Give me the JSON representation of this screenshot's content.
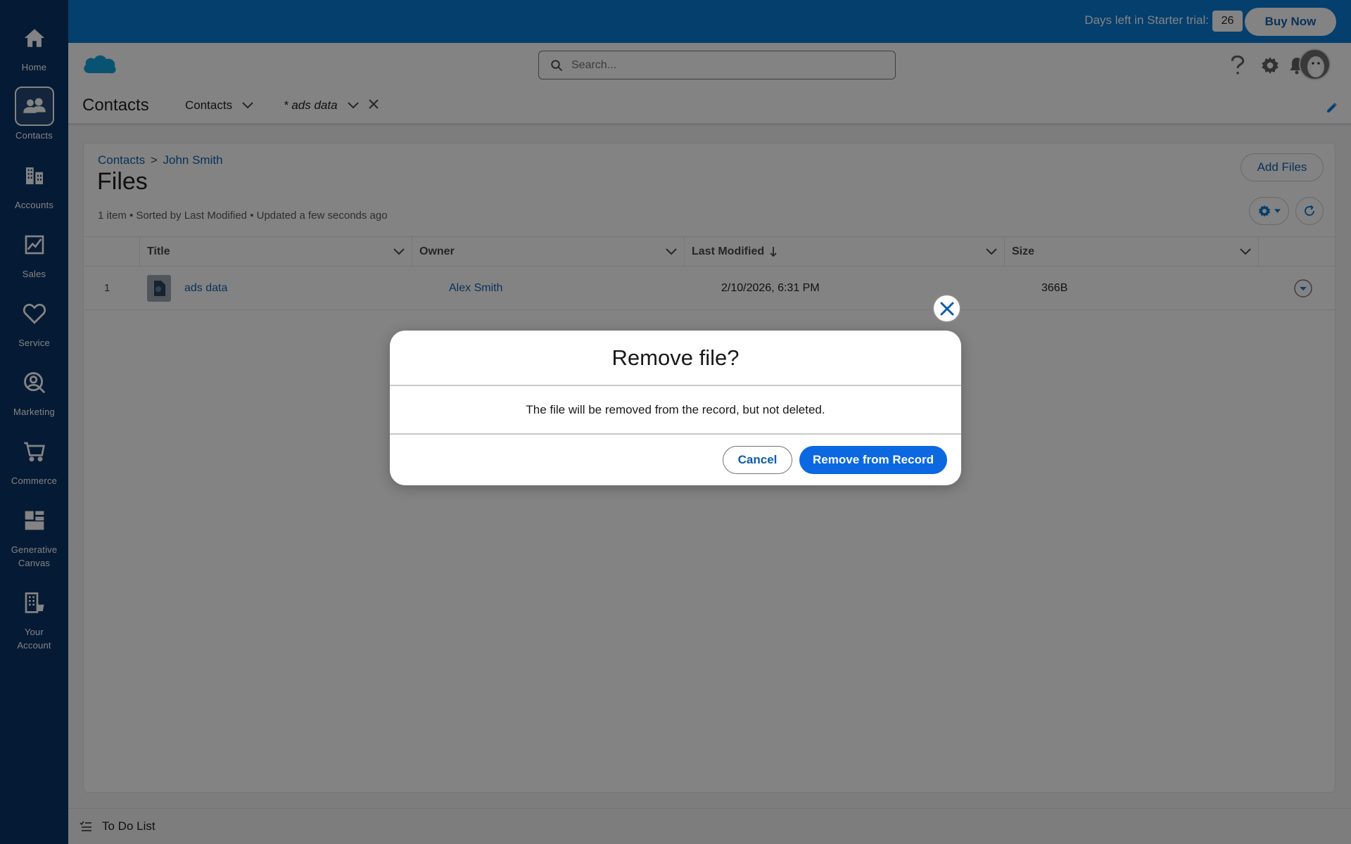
{
  "rail": {
    "items": [
      {
        "label": "Home",
        "icon": "home-icon"
      },
      {
        "label": "Contacts",
        "icon": "contacts-icon"
      },
      {
        "label": "Accounts",
        "icon": "accounts-icon"
      },
      {
        "label": "Sales",
        "icon": "sales-icon"
      },
      {
        "label": "Service",
        "icon": "service-icon"
      },
      {
        "label": "Marketing",
        "icon": "marketing-icon"
      },
      {
        "label": "Commerce",
        "icon": "commerce-icon"
      },
      {
        "label": "Generative\nCanvas",
        "icon": "canvas-icon"
      },
      {
        "label": "Your\nAccount",
        "icon": "your-account-icon"
      }
    ]
  },
  "trial": {
    "text": "Days left in Starter trial:",
    "days": "26",
    "buy_label": "Buy Now"
  },
  "header": {
    "search_placeholder": "Search..."
  },
  "nav": {
    "app_name": "Contacts",
    "tabs": [
      {
        "label": "Contacts"
      },
      {
        "label": "* ads data"
      }
    ]
  },
  "page": {
    "breadcrumb_root": "Contacts",
    "breadcrumb_sep": ">",
    "breadcrumb_record": "John Smith",
    "title": "Files",
    "meta": "1 item • Sorted by Last Modified • Updated a few seconds ago",
    "add_files_label": "Add Files"
  },
  "table": {
    "columns": [
      "Title",
      "Owner",
      "Last Modified",
      "Size"
    ],
    "rows": [
      {
        "index": "1",
        "title": "ads data",
        "owner": "Alex Smith",
        "modified": "2/10/2026, 6:31 PM",
        "size": "366B"
      }
    ]
  },
  "utility": {
    "todo_label": "To Do List"
  },
  "modal": {
    "title": "Remove file?",
    "body": "The file will be removed from the record, but not deleted.",
    "cancel_label": "Cancel",
    "confirm_label": "Remove from Record"
  },
  "colors": {
    "rail": "#032d60",
    "brand": "#0176d3",
    "primary_button": "#0b68e0",
    "link": "#0b5cab"
  }
}
